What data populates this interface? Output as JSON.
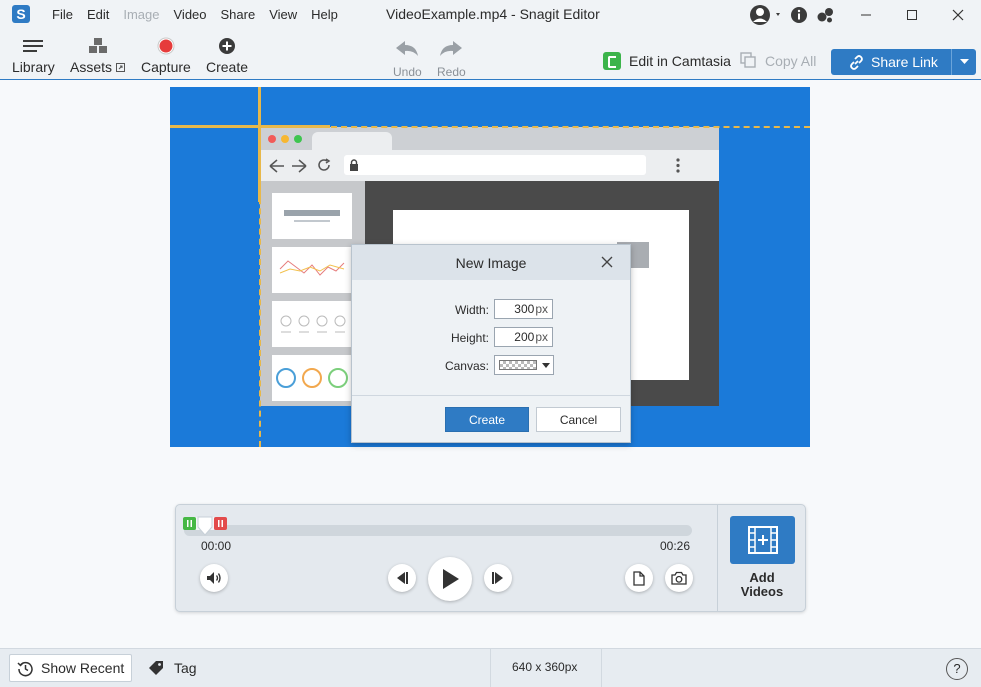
{
  "app": {
    "logo_letter": "S",
    "title": "VideoExample.mp4 - Snagit Editor"
  },
  "menu": [
    {
      "label": "File",
      "enabled": true
    },
    {
      "label": "Edit",
      "enabled": true
    },
    {
      "label": "Image",
      "enabled": false
    },
    {
      "label": "Video",
      "enabled": true
    },
    {
      "label": "Share",
      "enabled": true
    },
    {
      "label": "View",
      "enabled": true
    },
    {
      "label": "Help",
      "enabled": true
    }
  ],
  "toolbar": {
    "library": "Library",
    "assets": "Assets",
    "capture": "Capture",
    "create": "Create",
    "undo": "Undo",
    "redo": "Redo",
    "edit_in_camtasia": "Edit in Camtasia",
    "copy_all": "Copy All",
    "share_link": "Share Link"
  },
  "colors": {
    "accent": "#2f7bc4",
    "canvas_bg": "#1b7ad9",
    "capture_red": "#e63b3b",
    "camtasia_green": "#3cb44b"
  },
  "dialog": {
    "title": "New Image",
    "width_label": "Width:",
    "width_value": "300",
    "height_label": "Height:",
    "height_value": "200",
    "unit": "px",
    "canvas_label": "Canvas:",
    "create_label": "Create",
    "cancel_label": "Cancel"
  },
  "video": {
    "time_start": "00:00",
    "time_end": "00:26",
    "add_videos_line1": "Add",
    "add_videos_line2": "Videos"
  },
  "status": {
    "show_recent": "Show Recent",
    "tag": "Tag",
    "dimensions": "640 x 360px",
    "help": "?"
  }
}
